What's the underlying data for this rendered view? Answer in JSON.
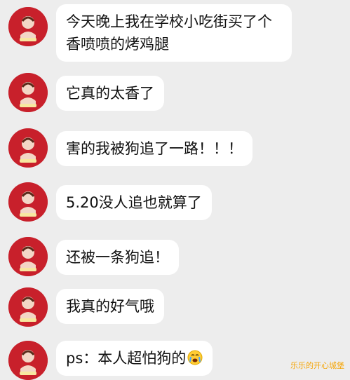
{
  "messages": [
    {
      "text": "今天晚上我在学校小吃街买了个香喷喷的烤鸡腿",
      "avatar_icon": "red-circle-avatar-icon"
    },
    {
      "text": "它真的太香了",
      "avatar_icon": "red-circle-avatar-icon"
    },
    {
      "text": "害的我被狗追了一路！！！",
      "avatar_icon": "red-circle-avatar-icon"
    },
    {
      "text": "5.20没人追也就算了",
      "avatar_icon": "red-circle-avatar-icon"
    },
    {
      "text": "还被一条狗追！",
      "avatar_icon": "red-circle-avatar-icon"
    },
    {
      "text": "我真的好气哦",
      "avatar_icon": "red-circle-avatar-icon"
    },
    {
      "text": "ps：本人超怕狗的",
      "avatar_icon": "red-circle-avatar-icon",
      "trailing_icon": "crying-face-emoji-icon"
    }
  ],
  "watermark": "乐乐的开心城堡",
  "colors": {
    "background": "#ededed",
    "bubble": "#ffffff",
    "avatar": "#c8202b",
    "watermark": "#f0a000"
  }
}
